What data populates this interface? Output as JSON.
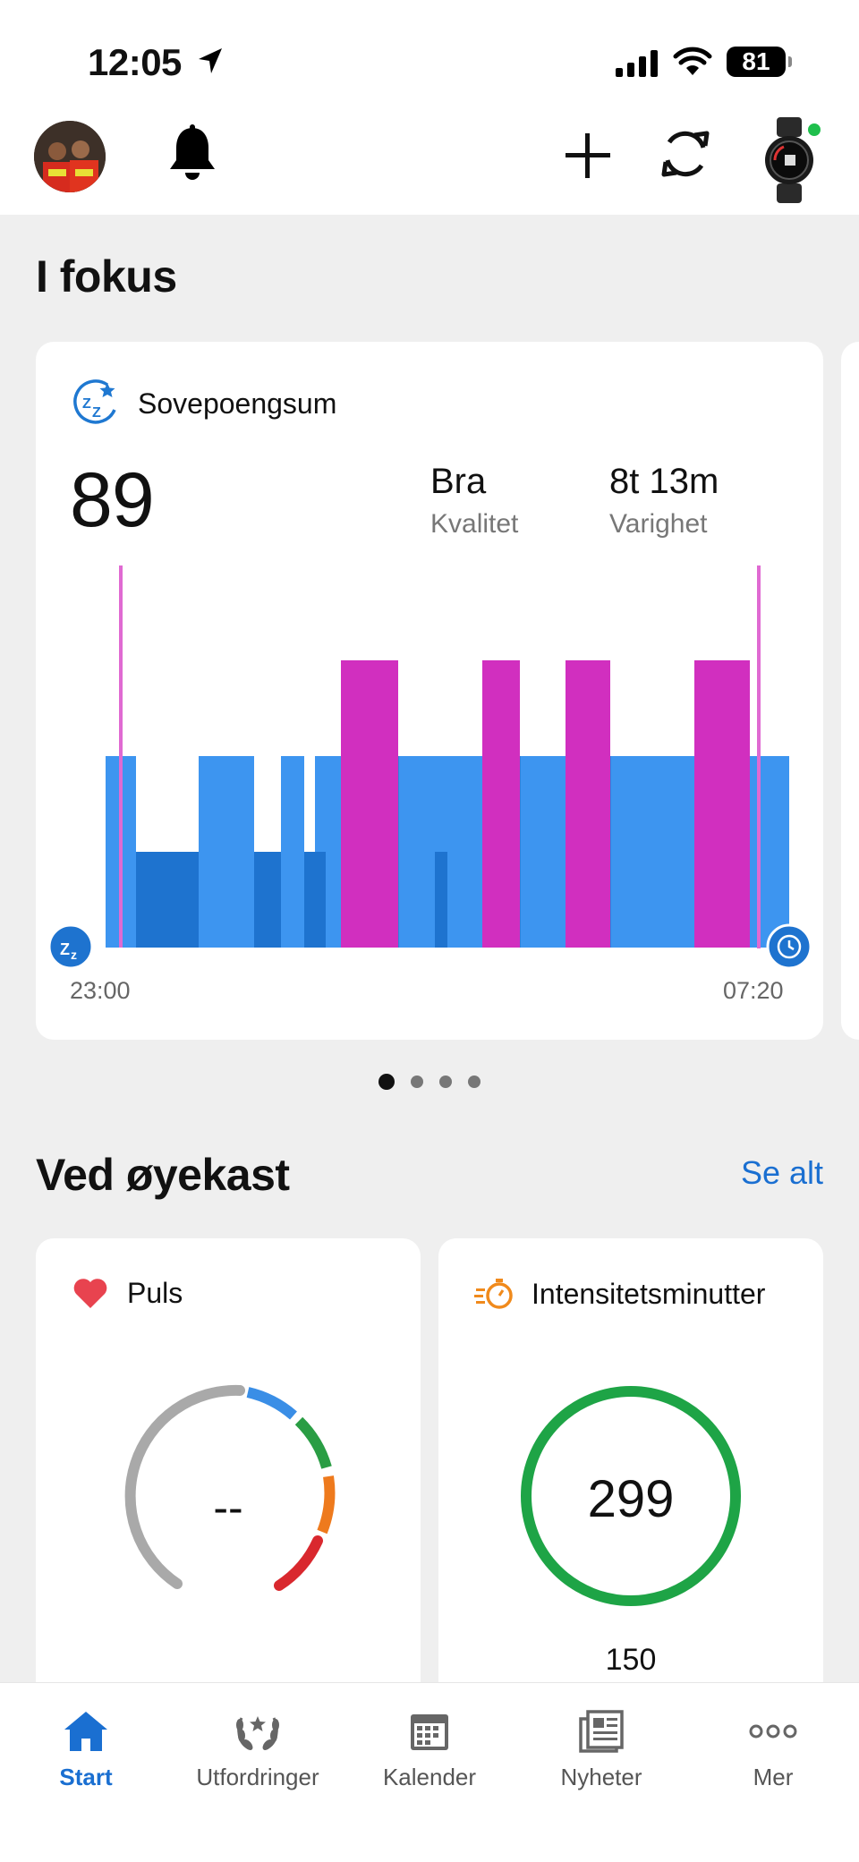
{
  "status_bar": {
    "time": "12:05",
    "battery": "81"
  },
  "header": {
    "notifications_icon": "bell-icon",
    "add_icon": "plus-icon",
    "sync_icon": "sync-icon",
    "device_icon": "watch-icon"
  },
  "focus": {
    "title": "I fokus",
    "sleep_card": {
      "label": "Sovepoengsum",
      "score": "89",
      "quality_value": "Bra",
      "quality_label": "Kvalitet",
      "duration_value": "8t 13m",
      "duration_label": "Varighet",
      "start_time": "23:00",
      "end_time": "07:20",
      "colors": {
        "deep": "#1e73cf",
        "light": "#3d95f0",
        "rem": "#d12fbf",
        "awake": "#e06ad2"
      }
    },
    "pager": {
      "count": 4,
      "active": 0
    }
  },
  "glance": {
    "title": "Ved øyekast",
    "see_all": "Se alt",
    "heart_rate": {
      "label": "Puls",
      "value": "--"
    },
    "intensity": {
      "label": "Intensitetsminutter",
      "value": "299",
      "goal": "150",
      "ring_color": "#1ea446"
    }
  },
  "tabs": [
    {
      "label": "Start",
      "icon": "home-icon",
      "active": true
    },
    {
      "label": "Utfordringer",
      "icon": "laurel-icon",
      "active": false
    },
    {
      "label": "Kalender",
      "icon": "calendar-icon",
      "active": false
    },
    {
      "label": "Nyheter",
      "icon": "news-icon",
      "active": false
    },
    {
      "label": "Mer",
      "icon": "more-icon",
      "active": false
    }
  ]
}
